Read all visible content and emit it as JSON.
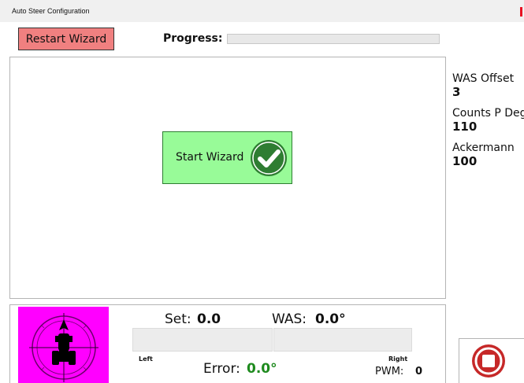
{
  "window": {
    "title": "Auto Steer Configuration",
    "close_color": "#e81123"
  },
  "toolbar": {
    "restart_label": "Restart Wizard",
    "restart_color": "#f08080",
    "progress_label": "Progress:",
    "progress_fraction": 0
  },
  "main": {
    "start_label": "Start Wizard",
    "start_color": "#98fb98",
    "start_icon": "check-circle-icon"
  },
  "side": {
    "was_offset_label": "WAS Offset",
    "was_offset_value": "3",
    "counts_label": "Counts P Deg",
    "counts_value": "110",
    "ackermann_label": "Ackermann",
    "ackermann_value": "100"
  },
  "status": {
    "set_label": "Set:",
    "set_value": "0.0",
    "was_label": "WAS:",
    "was_value": "0.0°",
    "left_label": "Left",
    "right_label": "Right",
    "error_label": "Error:",
    "error_value": "0.0°",
    "error_color": "#1e8a1e",
    "pwm_label": "PWM:",
    "pwm_value": "0",
    "compass_color": "#ff00ff",
    "compass_icon": "tractor-compass-icon",
    "stop_icon": "stop-button-icon"
  }
}
